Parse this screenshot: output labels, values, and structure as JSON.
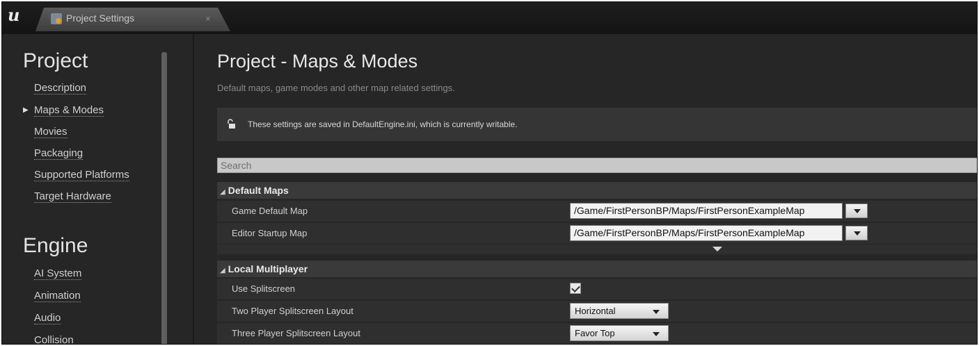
{
  "window": {
    "logo_text": "u",
    "tab_title": "Project Settings",
    "tab_close": "×"
  },
  "nav": {
    "project_heading": "Project",
    "project_items": [
      {
        "label": "Description"
      },
      {
        "label": "Maps & Modes",
        "selected": true
      },
      {
        "label": "Movies"
      },
      {
        "label": "Packaging"
      },
      {
        "label": "Supported Platforms"
      },
      {
        "label": "Target Hardware"
      }
    ],
    "engine_heading": "Engine",
    "engine_items": [
      {
        "label": "AI System"
      },
      {
        "label": "Animation"
      },
      {
        "label": "Audio"
      },
      {
        "label": "Collision"
      }
    ]
  },
  "main": {
    "title": "Project - Maps & Modes",
    "subtitle": "Default maps, game modes and other map related settings.",
    "notice": "These settings are saved in DefaultEngine.ini, which is currently writable.",
    "search_placeholder": "Search",
    "sections": [
      {
        "name": "Default Maps",
        "rows": [
          {
            "label": "Game Default Map",
            "value": "/Game/FirstPersonBP/Maps/FirstPersonExampleMap"
          },
          {
            "label": "Editor Startup Map",
            "value": "/Game/FirstPersonBP/Maps/FirstPersonExampleMap"
          }
        ]
      },
      {
        "name": "Local Multiplayer",
        "rows": [
          {
            "label": "Use Splitscreen",
            "checked": true
          },
          {
            "label": "Two Player Splitscreen Layout",
            "value": "Horizontal"
          },
          {
            "label": "Three Player Splitscreen Layout",
            "value": "Favor Top"
          }
        ]
      }
    ]
  },
  "colors": {
    "background": "#262626",
    "section_header": "#3a3a3a",
    "row": "#2f2f2f"
  }
}
